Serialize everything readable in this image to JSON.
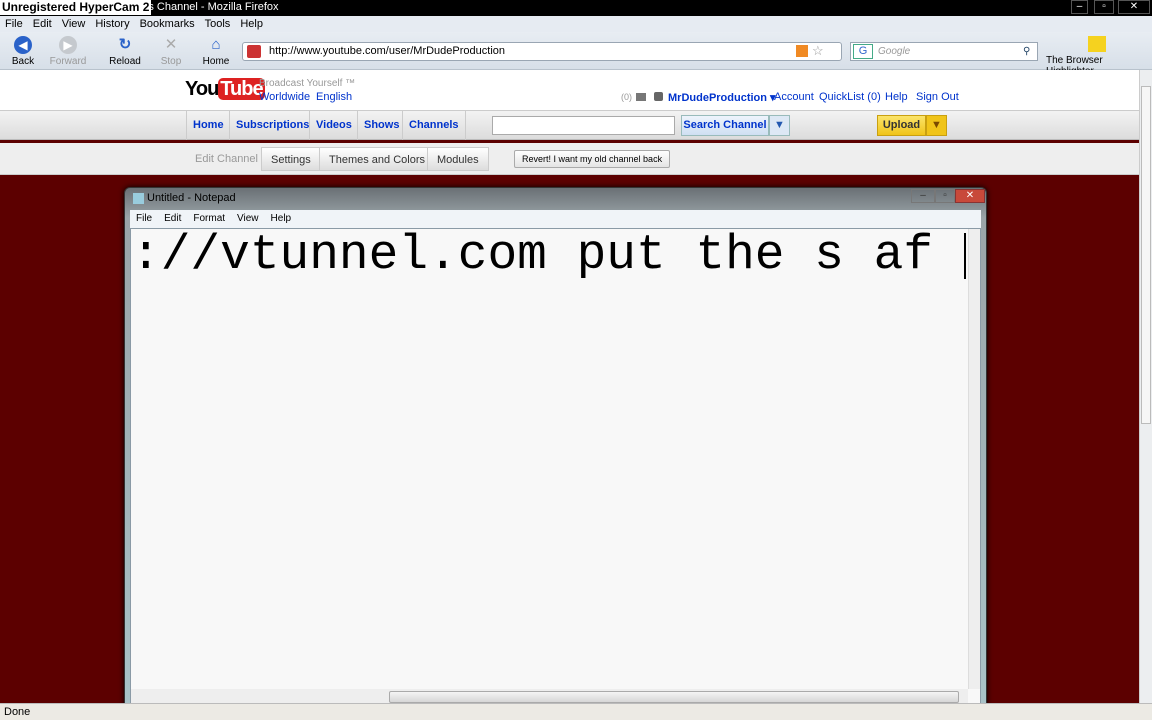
{
  "recorder_banner": "Unregistered HyperCam 2",
  "window_title": "on's Channel - Mozilla Firefox",
  "firefox": {
    "menu": [
      "File",
      "Edit",
      "View",
      "History",
      "Bookmarks",
      "Tools",
      "Help"
    ],
    "toolbar": {
      "back": "Back",
      "forward": "Forward",
      "reload": "Reload",
      "stop": "Stop",
      "home": "Home"
    },
    "url": "http://www.youtube.com/user/MrDudeProduction",
    "search_placeholder": "Google",
    "extension": "The Browser Highlighter",
    "status": "Done"
  },
  "youtube": {
    "logo": "YouTube",
    "tagline": "Broadcast Yourself ™",
    "worldwide": "Worldwide",
    "language": "English",
    "inbox_count": "(0)",
    "username": "MrDudeProduction",
    "account": "Account",
    "quicklist": "QuickList (0)",
    "help": "Help",
    "signout": "Sign Out",
    "nav": [
      "Home",
      "Subscriptions",
      "Videos",
      "Shows",
      "Channels"
    ],
    "search_button": "Search Channel",
    "upload": "Upload",
    "edit_channel": "Edit Channel",
    "edit_tabs": [
      "Settings",
      "Themes and Colors",
      "Modules"
    ],
    "revert": "Revert! I want my old channel back",
    "background_color": "#5c0000"
  },
  "notepad": {
    "title": "Untitled - Notepad",
    "menu": [
      "File",
      "Edit",
      "Format",
      "View",
      "Help"
    ],
    "text": "://vtunnel.com put the s af"
  }
}
